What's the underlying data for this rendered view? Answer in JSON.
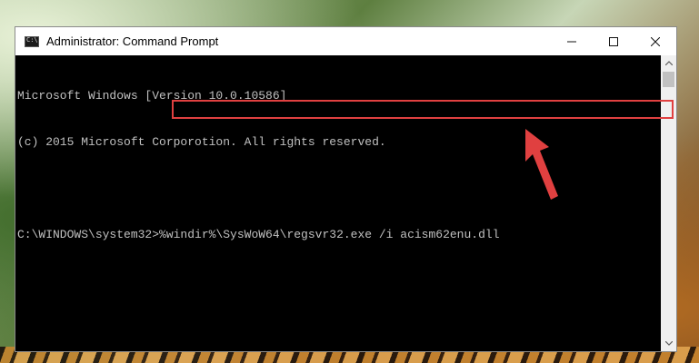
{
  "window": {
    "title": "Administrator: Command Prompt",
    "icon": "cmd-icon"
  },
  "controls": {
    "minimize": "minimize-icon",
    "maximize": "maximize-icon",
    "close": "close-icon"
  },
  "console": {
    "lines": [
      "Microsoft Windows [Version 10.0.10586]",
      "(c) 2015 Microsoft Corporotion. All rights reserved."
    ],
    "prompt": "C:\\WINDOWS\\system32>",
    "command": "%windir%\\SysWoW64\\regsvr32.exe /i acism62enu.dll"
  },
  "annotation": {
    "highlight_color": "#e04040",
    "arrow_color": "#e04040"
  }
}
